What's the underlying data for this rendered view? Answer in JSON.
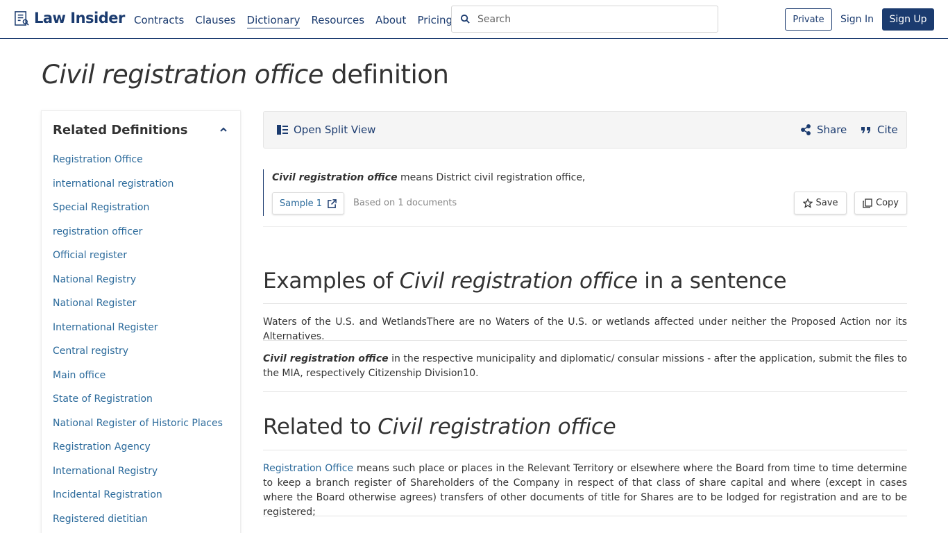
{
  "header": {
    "logo_text": "Law Insider",
    "nav": [
      "Contracts",
      "Clauses",
      "Dictionary",
      "Resources",
      "About",
      "Pricing"
    ],
    "active_nav": "Dictionary",
    "search_placeholder": "Search",
    "private_label": "Private",
    "signin_label": "Sign In",
    "signup_label": "Sign Up"
  },
  "title": {
    "term": "Civil registration office",
    "suffix": " definition"
  },
  "sidebar": {
    "heading": "Related Definitions",
    "items": [
      "Registration Office",
      "international registration",
      "Special Registration",
      "registration officer",
      "Official register",
      "National Registry",
      "National Register",
      "International Register",
      "Central registry",
      "Main office",
      "State of Registration",
      "National Register of Historic Places",
      "Registration Agency",
      "International Registry",
      "Incidental Registration",
      "Registered dietitian"
    ]
  },
  "toolbar": {
    "split_view": "Open Split View",
    "share": "Share",
    "cite": "Cite"
  },
  "definition": {
    "term": "Civil registration office",
    "text": " means District civil registration office,",
    "sample_label": "Sample 1",
    "based_on": "Based on 1 documents",
    "save_label": "Save",
    "copy_label": "Copy"
  },
  "examples": {
    "title_prefix": "Examples of ",
    "title_term": "Civil registration office",
    "title_suffix": " in a sentence",
    "items": [
      {
        "bold": "",
        "text": "Waters of the U.S. and WetlandsThere are no Waters of the U.S. or wetlands affected under neither the Proposed Action nor its Alternatives."
      },
      {
        "bold": "Civil registration office",
        "text": " in the respective municipality and diplomatic/ consular missions - after the application, submit the files to the MIA, respectively Citizenship Division10."
      }
    ]
  },
  "related": {
    "title_prefix": "Related to ",
    "title_term": "Civil registration office",
    "items": [
      {
        "term": "Registration Office",
        "text": " means such place or places in the Relevant Territory or elsewhere where the Board from time to time determine to keep a branch register of Shareholders of the Company in respect of that class of share capital and where (except in cases where the Board otherwise agrees) transfers of other documents of title for Shares are to be lodged for registration and are to be registered;"
      }
    ]
  },
  "colors": {
    "brand": "#1b3b6f",
    "link": "#2b6a9b"
  }
}
